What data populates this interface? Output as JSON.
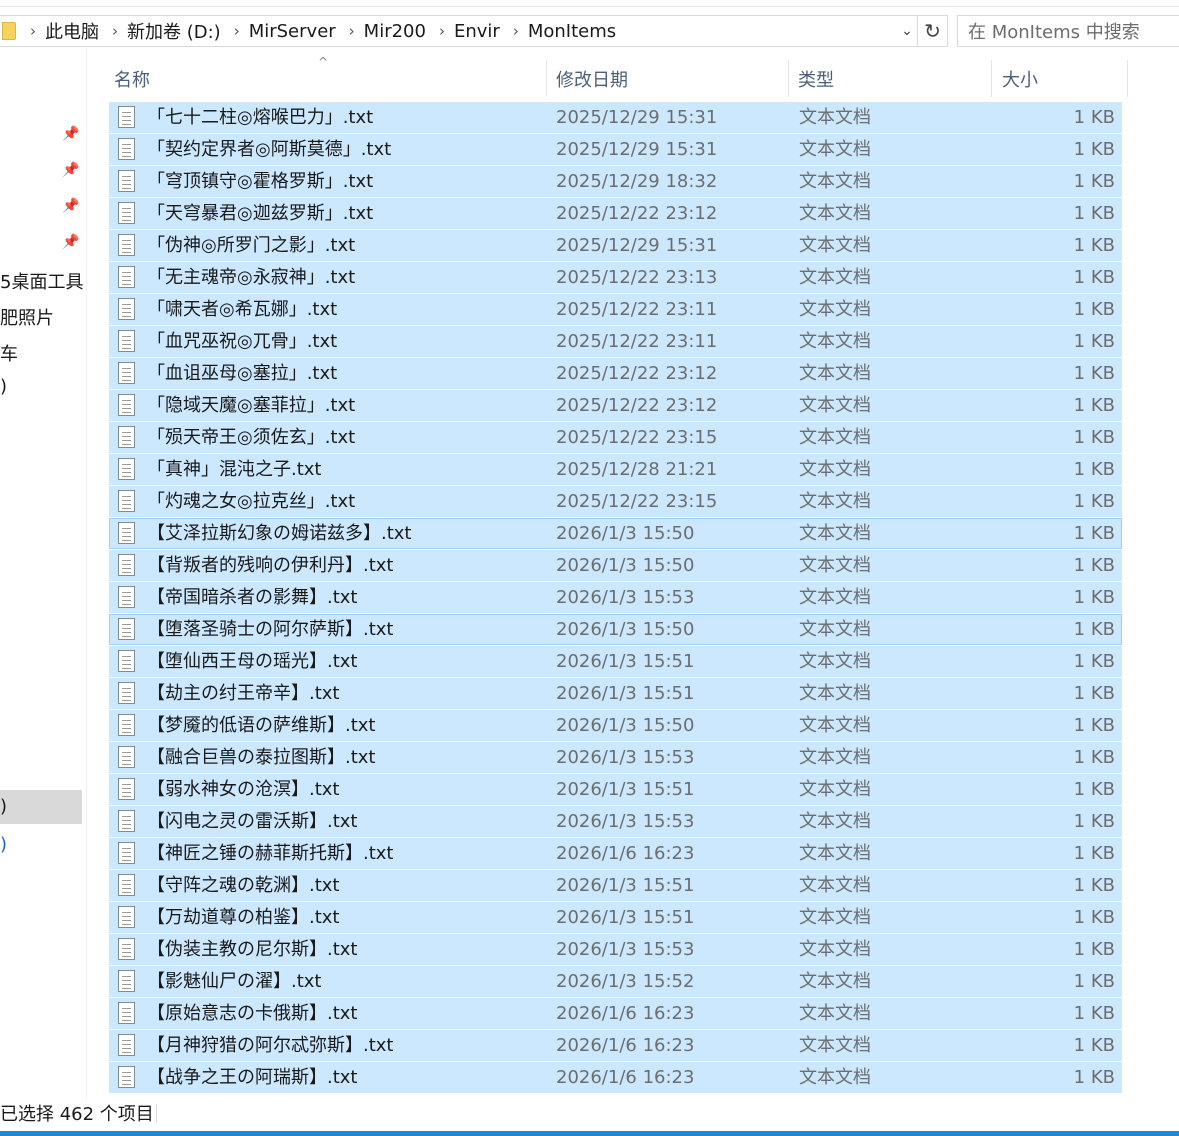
{
  "address_bar": {
    "breadcrumbs": [
      "此电脑",
      "新加卷 (D:)",
      "MirServer",
      "Mir200",
      "Envir",
      "MonItems"
    ]
  },
  "search": {
    "placeholder": "在 MonItems 中搜索"
  },
  "icons": {
    "breadcrumb_separator": "›",
    "dropdown": "⌄",
    "refresh": "↻",
    "pin": "📌"
  },
  "nav_pane": {
    "items": [
      "5桌面工具",
      "肥照片",
      "车",
      ")",
      ")",
      ")"
    ]
  },
  "columns": {
    "name": "名称",
    "date": "修改日期",
    "type": "类型",
    "size": "大小"
  },
  "files": [
    {
      "name": "「七十二柱◎熔喉巴力」.txt",
      "date": "2025/12/29 15:31",
      "type": "文本文档",
      "size": "1 KB"
    },
    {
      "name": "「契约定界者◎阿斯莫德」.txt",
      "date": "2025/12/29 15:31",
      "type": "文本文档",
      "size": "1 KB"
    },
    {
      "name": "「穹顶镇守◎霍格罗斯」.txt",
      "date": "2025/12/29 18:32",
      "type": "文本文档",
      "size": "1 KB"
    },
    {
      "name": "「天穹暴君◎迦兹罗斯」.txt",
      "date": "2025/12/22 23:12",
      "type": "文本文档",
      "size": "1 KB"
    },
    {
      "name": "「伪神◎所罗门之影」.txt",
      "date": "2025/12/29 15:31",
      "type": "文本文档",
      "size": "1 KB"
    },
    {
      "name": "「无主魂帝◎永寂神」.txt",
      "date": "2025/12/22 23:13",
      "type": "文本文档",
      "size": "1 KB"
    },
    {
      "name": "「啸天者◎希瓦娜」.txt",
      "date": "2025/12/22 23:11",
      "type": "文本文档",
      "size": "1 KB"
    },
    {
      "name": "「血咒巫祝◎兀骨」.txt",
      "date": "2025/12/22 23:11",
      "type": "文本文档",
      "size": "1 KB"
    },
    {
      "name": "「血诅巫母◎塞拉」.txt",
      "date": "2025/12/22 23:12",
      "type": "文本文档",
      "size": "1 KB"
    },
    {
      "name": "「隐域天魔◎塞菲拉」.txt",
      "date": "2025/12/22 23:12",
      "type": "文本文档",
      "size": "1 KB"
    },
    {
      "name": "「殒天帝王◎须佐玄」.txt",
      "date": "2025/12/22 23:15",
      "type": "文本文档",
      "size": "1 KB"
    },
    {
      "name": "「真神」混沌之子.txt",
      "date": "2025/12/28 21:21",
      "type": "文本文档",
      "size": "1 KB"
    },
    {
      "name": "「灼魂之女◎拉克丝」.txt",
      "date": "2025/12/22 23:15",
      "type": "文本文档",
      "size": "1 KB"
    },
    {
      "name": "【艾泽拉斯幻象の姆诺兹多】.txt",
      "date": "2026/1/3 15:50",
      "type": "文本文档",
      "size": "1 KB"
    },
    {
      "name": "【背叛者的残响の伊利丹】.txt",
      "date": "2026/1/3 15:50",
      "type": "文本文档",
      "size": "1 KB"
    },
    {
      "name": "【帝国暗杀者の影舞】.txt",
      "date": "2026/1/3 15:53",
      "type": "文本文档",
      "size": "1 KB"
    },
    {
      "name": "【堕落圣骑士の阿尔萨斯】.txt",
      "date": "2026/1/3 15:50",
      "type": "文本文档",
      "size": "1 KB"
    },
    {
      "name": "【堕仙西王母の瑶光】.txt",
      "date": "2026/1/3 15:51",
      "type": "文本文档",
      "size": "1 KB"
    },
    {
      "name": "【劫主の纣王帝辛】.txt",
      "date": "2026/1/3 15:51",
      "type": "文本文档",
      "size": "1 KB"
    },
    {
      "name": "【梦魇的低语の萨维斯】.txt",
      "date": "2026/1/3 15:50",
      "type": "文本文档",
      "size": "1 KB"
    },
    {
      "name": "【融合巨兽の泰拉图斯】.txt",
      "date": "2026/1/3 15:53",
      "type": "文本文档",
      "size": "1 KB"
    },
    {
      "name": "【弱水神女の沧溟】.txt",
      "date": "2026/1/3 15:51",
      "type": "文本文档",
      "size": "1 KB"
    },
    {
      "name": "【闪电之灵の雷沃斯】.txt",
      "date": "2026/1/3 15:53",
      "type": "文本文档",
      "size": "1 KB"
    },
    {
      "name": "【神匠之锤の赫菲斯托斯】.txt",
      "date": "2026/1/6 16:23",
      "type": "文本文档",
      "size": "1 KB"
    },
    {
      "name": "【守阵之魂の乾渊】.txt",
      "date": "2026/1/3 15:51",
      "type": "文本文档",
      "size": "1 KB"
    },
    {
      "name": "【万劫道尊の柏鉴】.txt",
      "date": "2026/1/3 15:51",
      "type": "文本文档",
      "size": "1 KB"
    },
    {
      "name": "【伪装主教の尼尔斯】.txt",
      "date": "2026/1/3 15:53",
      "type": "文本文档",
      "size": "1 KB"
    },
    {
      "name": "【影魅仙尸の濯】.txt",
      "date": "2026/1/3 15:52",
      "type": "文本文档",
      "size": "1 KB"
    },
    {
      "name": "【原始意志の卡俄斯】.txt",
      "date": "2026/1/6 16:23",
      "type": "文本文档",
      "size": "1 KB"
    },
    {
      "name": "【月神狩猎の阿尔忒弥斯】.txt",
      "date": "2026/1/6 16:23",
      "type": "文本文档",
      "size": "1 KB"
    },
    {
      "name": "【战争之王の阿瑞斯】.txt",
      "date": "2026/1/6 16:23",
      "type": "文本文档",
      "size": "1 KB"
    }
  ],
  "status_bar": {
    "text": "已选择 462 个项目"
  },
  "colors": {
    "selection": "#cce8ff",
    "selection_border": "#99d1ff",
    "header_text": "#4c607a",
    "accent": "#1e88d4"
  }
}
